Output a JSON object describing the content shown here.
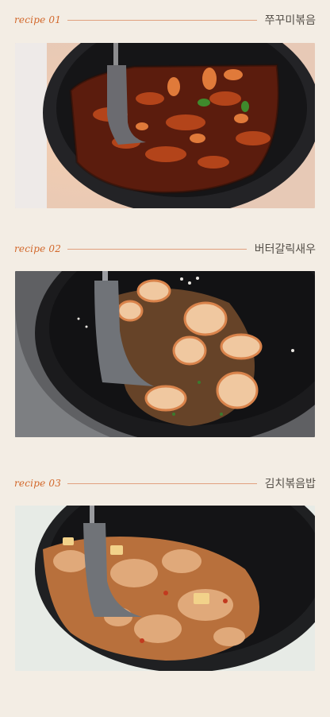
{
  "recipes": [
    {
      "tag": "recipe 01",
      "title": "쭈꾸미볶음"
    },
    {
      "tag": "recipe 02",
      "title": "버터갈릭새우"
    },
    {
      "tag": "recipe 03",
      "title": "김치볶음밥"
    }
  ],
  "colors": {
    "background": "#f3ede4",
    "accent": "#d2672a",
    "rule": "#e1a07e",
    "title_text": "#555049"
  }
}
